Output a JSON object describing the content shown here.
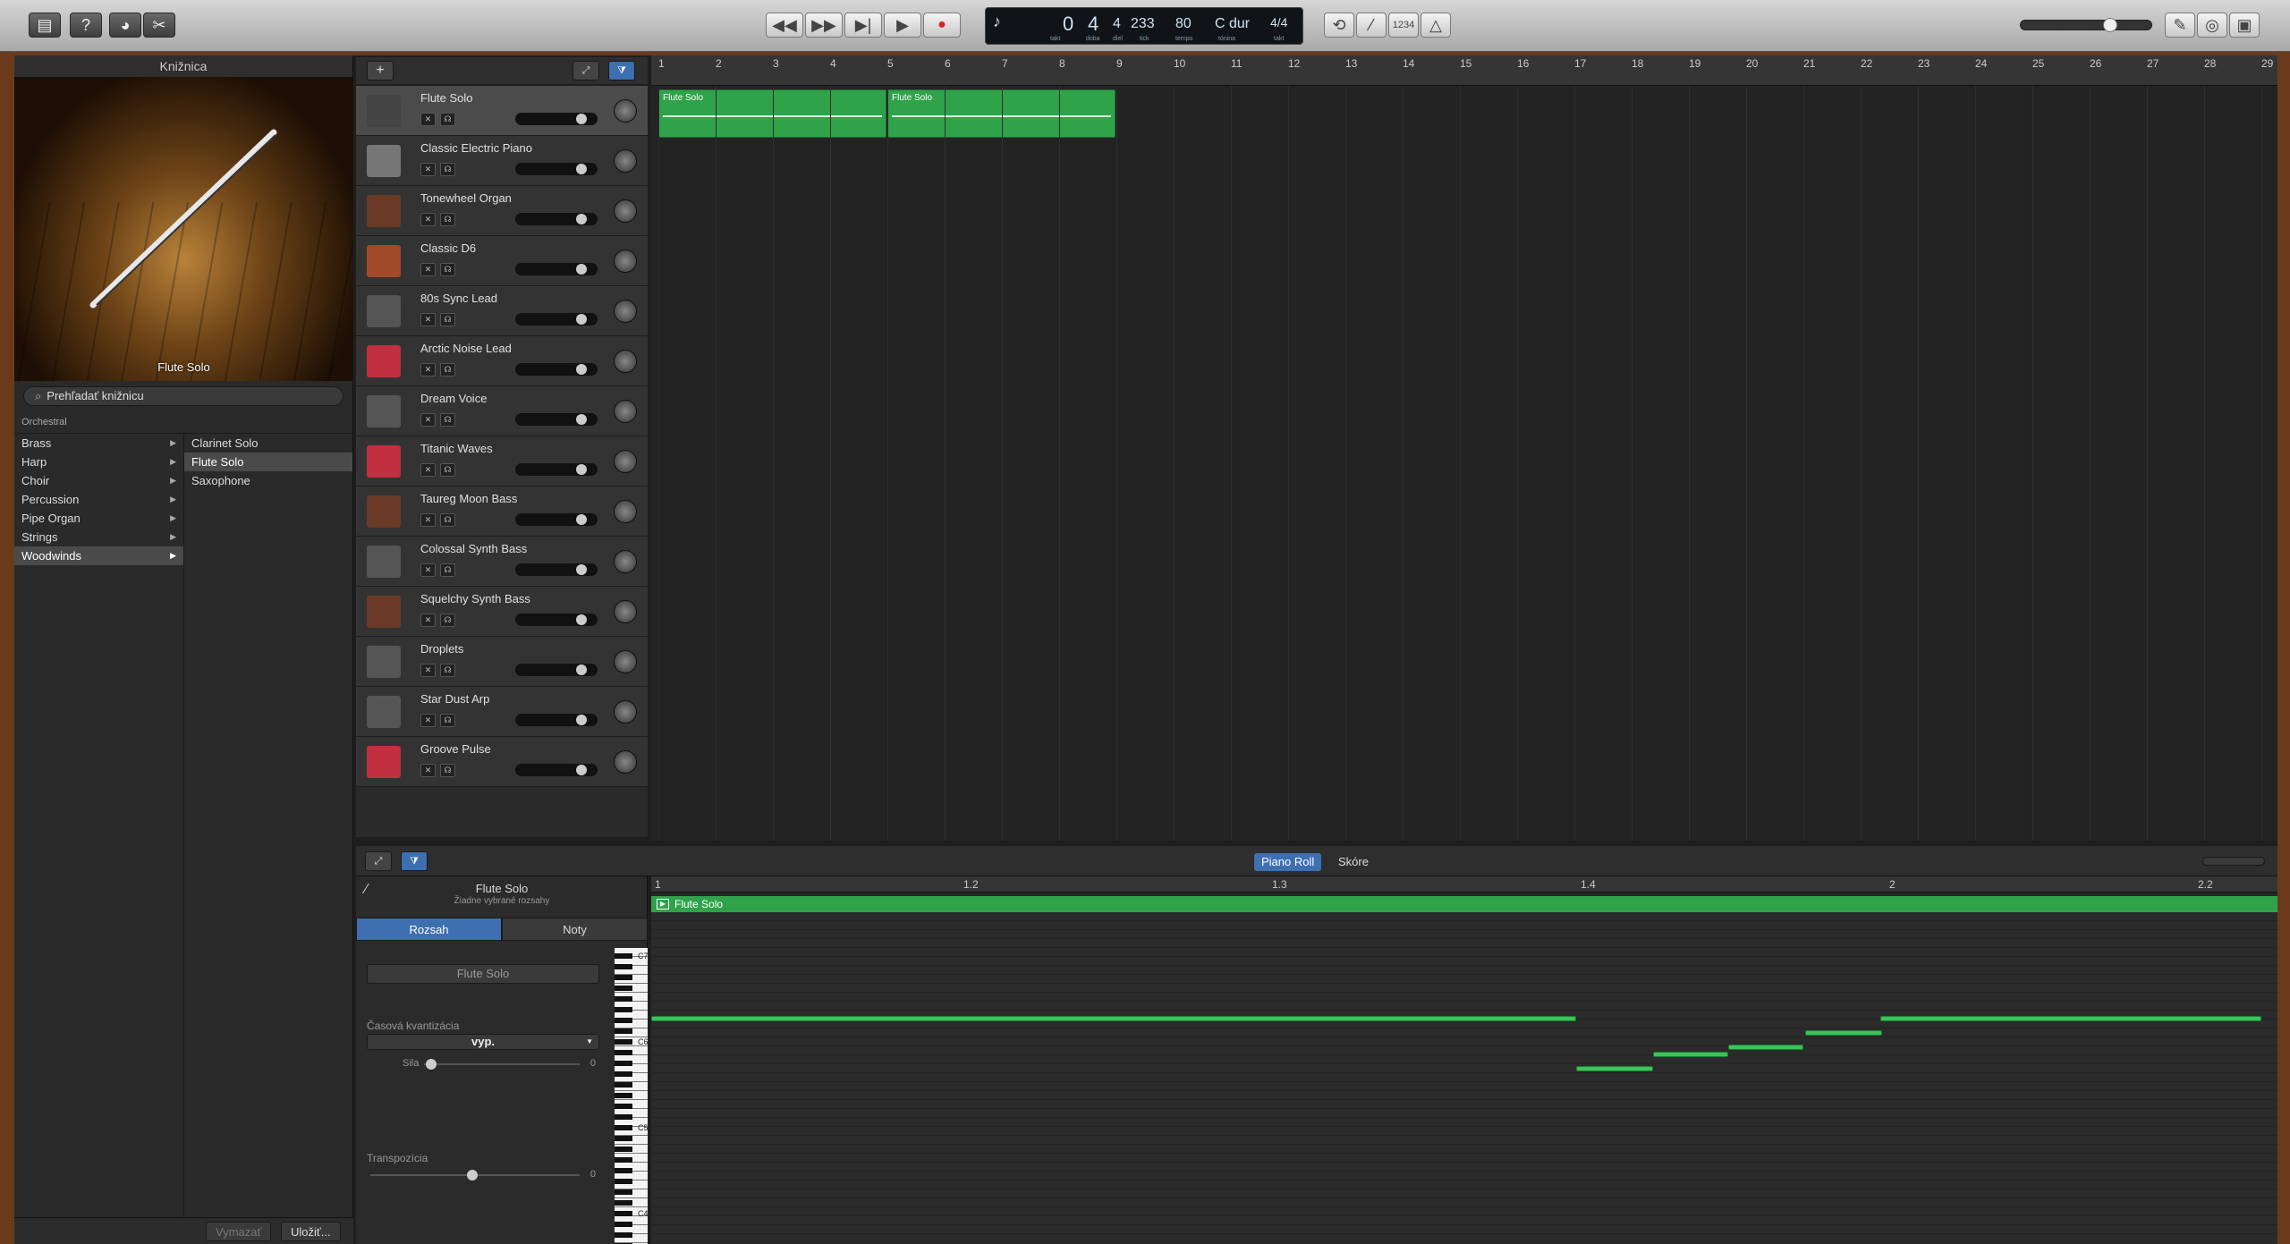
{
  "toolbar": {
    "lcd": {
      "bar": "0",
      "beat": "4",
      "div": "4",
      "tick": "233",
      "bpm": "80",
      "key": "C dur",
      "sig": "4/4",
      "lbl_bar": "takt",
      "lbl_beat": "doba",
      "lbl_div": "diel",
      "lbl_tick": "tick",
      "lbl_bpm": "tempo",
      "lbl_key": "tónina",
      "lbl_sig": "takt"
    },
    "count_in": "1234"
  },
  "library": {
    "title": "Knižnica",
    "preset": "Flute Solo",
    "search_placeholder": "Prehľadať knižnicu",
    "breadcrumb": "Orchestral",
    "categories": [
      "Brass",
      "Harp",
      "Choir",
      "Percussion",
      "Pipe Organ",
      "Strings",
      "Woodwinds"
    ],
    "presets": [
      "Clarinet Solo",
      "Flute Solo",
      "Saxophone"
    ],
    "delete_label": "Vymazať",
    "save_label": "Uložiť..."
  },
  "tracks": [
    {
      "name": "Flute Solo"
    },
    {
      "name": "Classic Electric Piano"
    },
    {
      "name": "Tonewheel Organ"
    },
    {
      "name": "Classic D6"
    },
    {
      "name": "80s Sync Lead"
    },
    {
      "name": "Arctic Noise Lead"
    },
    {
      "name": "Dream Voice"
    },
    {
      "name": "Titanic Waves"
    },
    {
      "name": "Taureg Moon Bass"
    },
    {
      "name": "Colossal Synth Bass"
    },
    {
      "name": "Squelchy Synth Bass"
    },
    {
      "name": "Droplets"
    },
    {
      "name": "Star Dust Arp"
    },
    {
      "name": "Groove Pulse"
    }
  ],
  "regions": [
    {
      "name": "Flute Solo"
    },
    {
      "name": "Flute Solo"
    }
  ],
  "editor": {
    "tab_piano": "Piano Roll",
    "tab_score": "Skóre",
    "track_name": "Flute Solo",
    "track_sub": "Žiadne vybrané rozsahy",
    "tab_region": "Rozsah",
    "tab_notes": "Noty",
    "region_name": "Flute Solo",
    "quant_label": "Časová kvantizácia",
    "quant_value": "vyp.",
    "strength_label": "Sila",
    "strength_value": "0",
    "transpose_label": "Transpozícia",
    "transpose_value": "0",
    "roll_region": "Flute Solo",
    "ruler": [
      "1",
      "1.2",
      "1.3",
      "1.4",
      "2",
      "2.2"
    ],
    "keys": [
      "C7",
      "C6",
      "C5",
      "C4"
    ]
  }
}
